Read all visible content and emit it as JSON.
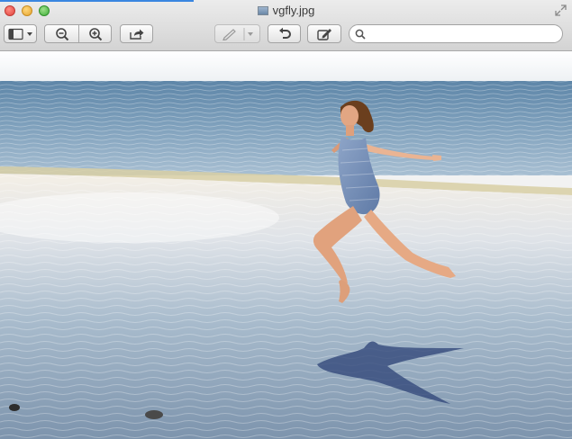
{
  "window": {
    "title": "vgfly.jpg"
  },
  "toolbar": {
    "buttons": [
      {
        "name": "sidebar-view-button",
        "icon": "sidebar-icon"
      },
      {
        "name": "zoom-out-button",
        "icon": "zoom-out-icon"
      },
      {
        "name": "zoom-in-button",
        "icon": "zoom-in-icon"
      },
      {
        "name": "share-button",
        "icon": "share-icon"
      },
      {
        "name": "markup-button",
        "icon": "pen-icon",
        "state": "disabled"
      },
      {
        "name": "rotate-button",
        "icon": "rotate-left-icon"
      },
      {
        "name": "edit-toolbar-button",
        "icon": "pencil-box-icon"
      }
    ],
    "search_value": "",
    "search_placeholder": ""
  },
  "colors": {
    "sky": "#f4f6f8",
    "sea": "#6d90ad",
    "sand_wet": "#9fb3c8",
    "accent_close": "#e0443e",
    "accent_min": "#e5a431",
    "accent_max": "#3fae3a"
  },
  "image": {
    "subject": "photo"
  }
}
